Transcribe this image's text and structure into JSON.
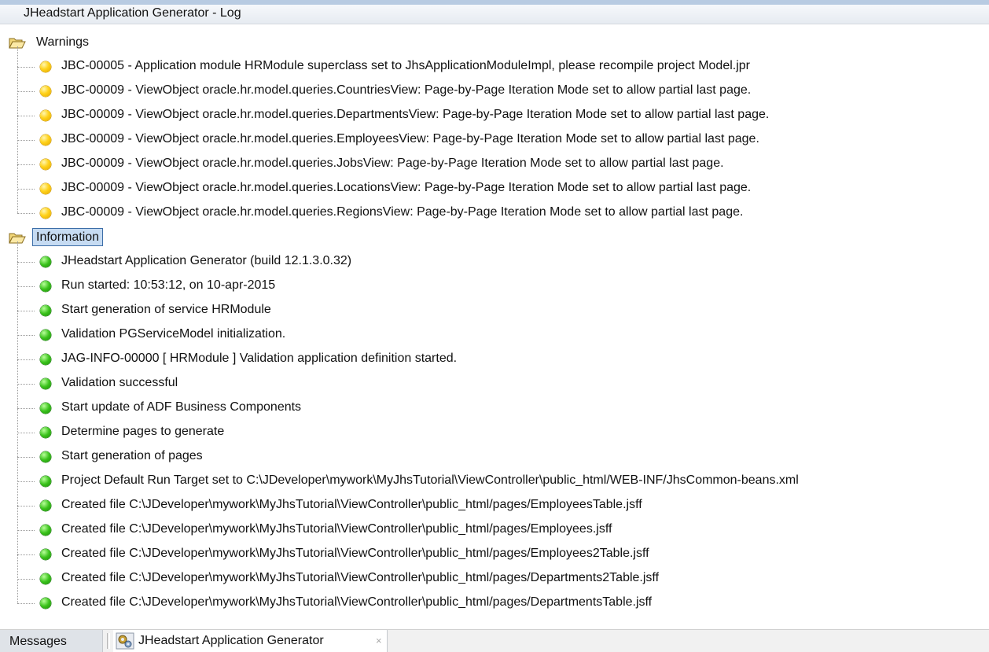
{
  "window": {
    "title": "JHeadstart Application Generator - Log"
  },
  "log": {
    "warnings": {
      "label": "Warnings",
      "items": [
        "JBC-00005 - Application module HRModule superclass set to JhsApplicationModuleImpl, please recompile project Model.jpr",
        "JBC-00009 - ViewObject oracle.hr.model.queries.CountriesView: Page-by-Page Iteration Mode set to allow partial last page.",
        "JBC-00009 - ViewObject oracle.hr.model.queries.DepartmentsView: Page-by-Page Iteration Mode set to allow partial last page.",
        "JBC-00009 - ViewObject oracle.hr.model.queries.EmployeesView: Page-by-Page Iteration Mode set to allow partial last page.",
        "JBC-00009 - ViewObject oracle.hr.model.queries.JobsView: Page-by-Page Iteration Mode set to allow partial last page.",
        "JBC-00009 - ViewObject oracle.hr.model.queries.LocationsView: Page-by-Page Iteration Mode set to allow partial last page.",
        "JBC-00009 - ViewObject oracle.hr.model.queries.RegionsView: Page-by-Page Iteration Mode set to allow partial last page."
      ]
    },
    "information": {
      "label": "Information",
      "items": [
        "JHeadstart Application Generator (build 12.1.3.0.32)",
        "Run started: 10:53:12, on 10-apr-2015",
        "Start generation of service HRModule",
        "Validation PGServiceModel initialization.",
        "JAG-INFO-00000 [ HRModule ] Validation application definition started.",
        "Validation successful",
        "Start update of ADF Business Components",
        "Determine pages to generate",
        "Start generation of pages",
        "Project Default Run Target set to C:\\JDeveloper\\mywork\\MyJhsTutorial\\ViewController\\public_html/WEB-INF/JhsCommon-beans.xml",
        "Created file C:\\JDeveloper\\mywork\\MyJhsTutorial\\ViewController\\public_html/pages/EmployeesTable.jsff",
        "Created file C:\\JDeveloper\\mywork\\MyJhsTutorial\\ViewController\\public_html/pages/Employees.jsff",
        "Created file C:\\JDeveloper\\mywork\\MyJhsTutorial\\ViewController\\public_html/pages/Employees2Table.jsff",
        "Created file C:\\JDeveloper\\mywork\\MyJhsTutorial\\ViewController\\public_html/pages/Departments2Table.jsff",
        "Created file C:\\JDeveloper\\mywork\\MyJhsTutorial\\ViewController\\public_html/pages/DepartmentsTable.jsff"
      ]
    }
  },
  "tabs": {
    "messages": "Messages",
    "generator": "JHeadstart Application Generator",
    "close_glyph": "×"
  },
  "icons": {
    "warning": "yellow-circle-icon",
    "info": "green-circle-icon",
    "folder": "open-folder-icon",
    "generator": "generator-icon"
  },
  "colors": {
    "warning": "#ffd21a",
    "info": "#39c21a",
    "selection": "#c6dbf2"
  }
}
